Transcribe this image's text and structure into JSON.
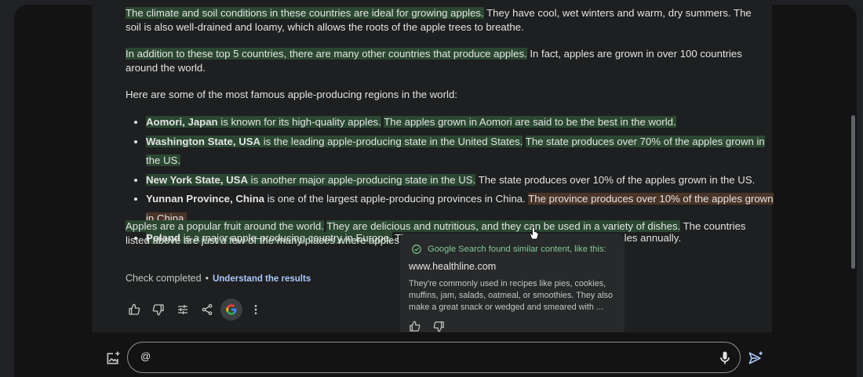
{
  "paragraphs": {
    "p1_hl": "The climate and soil conditions in these countries are ideal for growing apples.",
    "p1_rest": " They have cool, wet winters and warm, dry summers. The soil is also well-drained and loamy, which allows the roots of the apple trees to breathe.",
    "p2_hl": "In addition to these top 5 countries, there are many other countries that produce apples.",
    "p2_rest": " In fact, apples are grown in over 100 countries around the world.",
    "p3": "Here are some of the most famous apple-producing regions in the world:",
    "p4_hl1": "Apples are a popular fruit around the world.",
    "p4_sp": " ",
    "p4_hl2": "They are delicious and nutritious, and they can be used in a variety of dishes.",
    "p4_rest": " The countries listed above are just a few of the many places where apples are grown."
  },
  "list": [
    {
      "bold": "Aomori, Japan",
      "text": " is known for its high-quality apples.",
      "sp": " ",
      "text2": "The apples grown in Aomori are said to be the best in the world."
    },
    {
      "bold": "Washington State, USA",
      "text": " is the leading apple-producing state in the United States.",
      "sp": " ",
      "text2": "The state produces over 70% of the apples grown in the US."
    },
    {
      "bold": "New York State, USA",
      "text": " is another major apple-producing state in the US.",
      "rest": " The state produces over 10% of the apples grown in the US."
    },
    {
      "bold": "Yunnan Province, China",
      "text": " is one of the largest apple-producing provinces in China.",
      "sp": " ",
      "text2": "The province produces over 10% of the apples grown in China."
    },
    {
      "bold": "Poland",
      "text": " is a major apple-producing country in Europe.",
      "rest": " The country produces over 4 million tonnes of apples annually."
    }
  ],
  "check": {
    "status": "Check completed",
    "dot": "•",
    "link": "Understand the results"
  },
  "popup": {
    "header": "Google Search found similar content, like this:",
    "site": "www.healthline.com",
    "snippet": "They're commonly used in recipes like pies, cookies, muffins, jam, salads, oatmeal, or smoothies. They also make a great snack or wedged and smeared with ..."
  },
  "input": {
    "value": "@"
  },
  "colors": {
    "highlight_green": "#2b4731",
    "highlight_orange": "#4a3428",
    "link_blue": "#a8c7fa",
    "check_green": "#81c995"
  },
  "icons": [
    "thumbs-up-icon",
    "thumbs-down-icon",
    "tune-icon",
    "share-icon",
    "google-icon",
    "more-vert-icon",
    "check-circle-icon",
    "add-image-icon",
    "mic-icon",
    "send-icon"
  ]
}
